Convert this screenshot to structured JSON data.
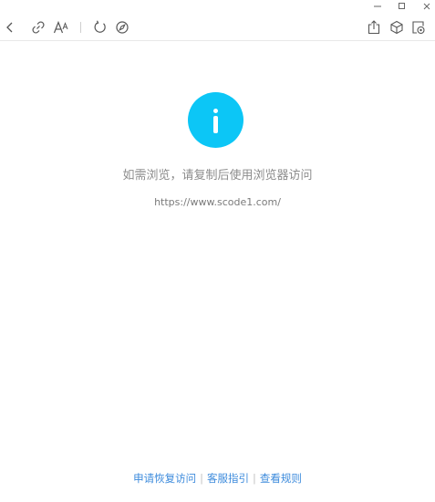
{
  "window_controls": {
    "minimize_icon": "minimize-icon",
    "maximize_icon": "maximize-icon",
    "close_icon": "close-icon"
  },
  "toolbar": {
    "left_icons": [
      "back-icon",
      "link-icon",
      "font-size-icon",
      "refresh-icon",
      "compass-icon"
    ],
    "right_icons": [
      "share-icon",
      "cube-icon",
      "screen-record-icon"
    ]
  },
  "content": {
    "message": "如需浏览，请复制后使用浏览器访问",
    "url": "https://www.scode1.com/",
    "icon": "info-icon",
    "icon_color": "#0cc6f6"
  },
  "footer": {
    "links": [
      "申请恢复访问",
      "客服指引",
      "查看规则"
    ],
    "separator": "|",
    "link_color": "#3d8bdc"
  }
}
